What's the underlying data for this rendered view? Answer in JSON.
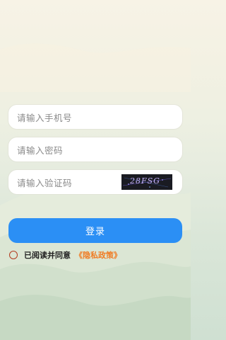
{
  "form": {
    "phone_placeholder": "请输入手机号",
    "password_placeholder": "请输入密码",
    "captcha_placeholder": "请输入验证码",
    "captcha_text": "28FSG"
  },
  "login_button": "登录",
  "agreement": {
    "text": "已阅读并同意",
    "policy_link": "《隐私政策》"
  },
  "colors": {
    "accent": "#2b8ff5",
    "link": "#f07c24",
    "radio": "#b33b1e"
  }
}
